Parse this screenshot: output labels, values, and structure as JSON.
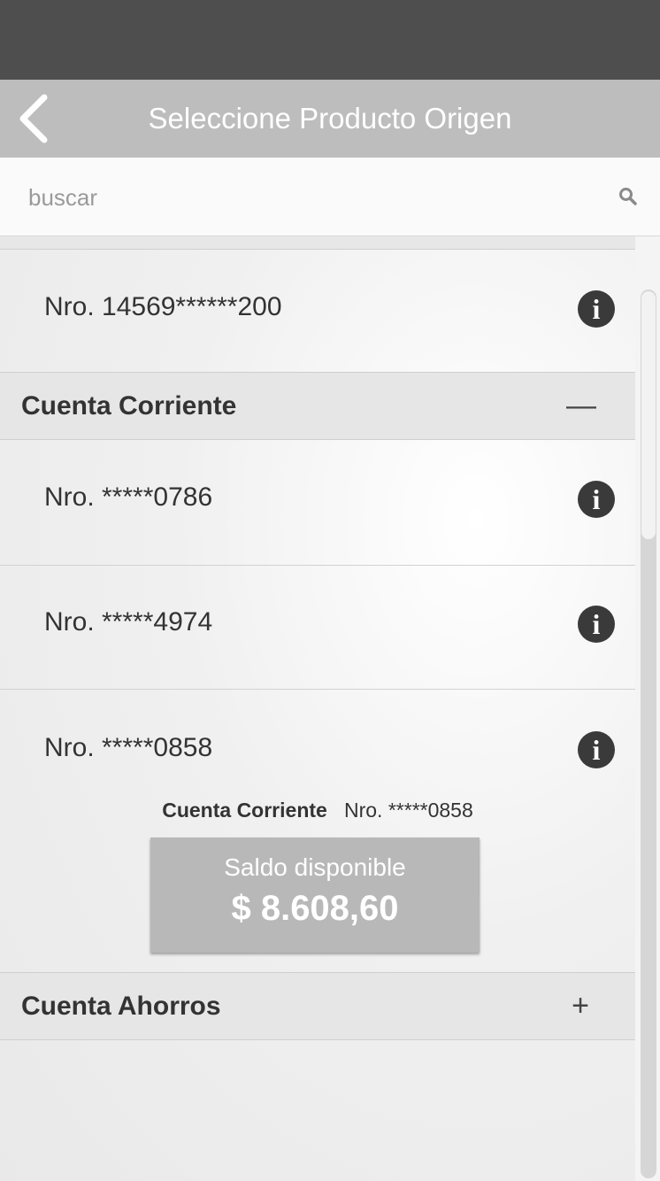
{
  "header": {
    "title": "Seleccione Producto Origen",
    "back_icon": "chevron-left-icon"
  },
  "search": {
    "placeholder": "buscar",
    "value": "",
    "icon": "search-icon"
  },
  "products": {
    "first_item": "Nro. 14569******200",
    "sections": [
      {
        "label": "Cuenta Corriente",
        "toggle": "—",
        "expanded": true,
        "items": [
          {
            "number": "Nro. *****0786"
          },
          {
            "number": "Nro. *****4974"
          },
          {
            "number": "Nro. *****0858"
          }
        ]
      },
      {
        "label": "Cuenta Ahorros",
        "toggle": "+",
        "expanded": false
      }
    ],
    "detail": {
      "type": "Cuenta Corriente",
      "number": "Nro. *****0858",
      "balance_label": "Saldo disponible",
      "balance_amount": "$ 8.608,60"
    }
  },
  "colors": {
    "status_bar": "#4e4e4e",
    "nav_bar": "#bdbdbd",
    "balance_box": "#b8b8b8"
  }
}
